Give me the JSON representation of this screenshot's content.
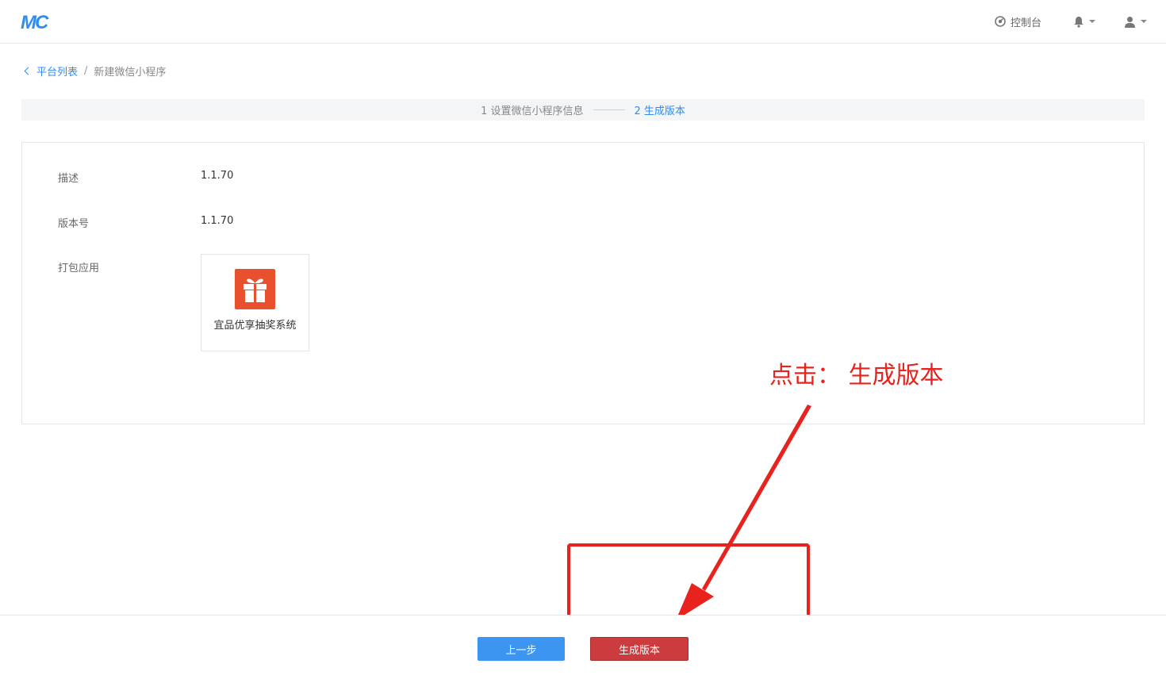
{
  "header": {
    "logo": "MC",
    "console_label": "控制台"
  },
  "breadcrumb": {
    "back_label": "平台列表",
    "separator": "/",
    "current": "新建微信小程序"
  },
  "steps": [
    {
      "label": "1 设置微信小程序信息",
      "active": false
    },
    {
      "label": "2 生成版本",
      "active": true
    }
  ],
  "form": {
    "description_label": "描述",
    "description_value": "1.1.70",
    "version_label": "版本号",
    "version_value": "1.1.70",
    "package_label": "打包应用",
    "app_name": "宜品优享抽奖系统"
  },
  "annotation": {
    "text": "点击： 生成版本",
    "color": "#e8221c"
  },
  "footer": {
    "prev_label": "上一步",
    "generate_label": "生成版本"
  },
  "colors": {
    "primary": "#2f8cf0",
    "danger": "#cc3b3e",
    "app_icon": "#e9502e"
  }
}
